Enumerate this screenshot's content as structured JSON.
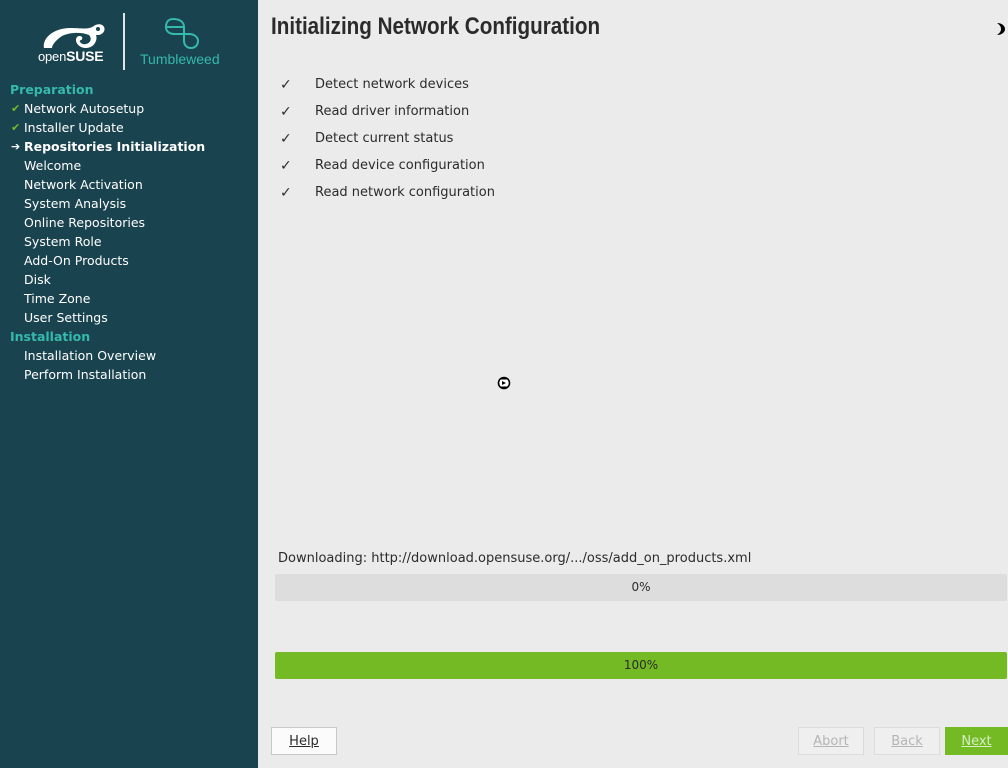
{
  "branding": {
    "product_prefix": "open",
    "product_suffix": "SUSE",
    "flavor": "Tumbleweed"
  },
  "sidebar": {
    "sections": [
      {
        "heading": "Preparation",
        "steps": [
          {
            "label": "Network Autosetup",
            "status": "done"
          },
          {
            "label": "Installer Update",
            "status": "done"
          },
          {
            "label": "Repositories Initialization",
            "status": "current"
          },
          {
            "label": "Welcome",
            "status": "pending"
          },
          {
            "label": "Network Activation",
            "status": "pending"
          },
          {
            "label": "System Analysis",
            "status": "pending"
          },
          {
            "label": "Online Repositories",
            "status": "pending"
          },
          {
            "label": "System Role",
            "status": "pending"
          },
          {
            "label": "Add-On Products",
            "status": "pending"
          },
          {
            "label": "Disk",
            "status": "pending"
          },
          {
            "label": "Time Zone",
            "status": "pending"
          },
          {
            "label": "User Settings",
            "status": "pending"
          }
        ]
      },
      {
        "heading": "Installation",
        "steps": [
          {
            "label": "Installation Overview",
            "status": "pending"
          },
          {
            "label": "Perform Installation",
            "status": "pending"
          }
        ]
      }
    ]
  },
  "main": {
    "title": "Initializing Network Configuration",
    "tasks": [
      {
        "label": "Detect network devices",
        "done": true
      },
      {
        "label": "Read driver information",
        "done": true
      },
      {
        "label": "Detect current status",
        "done": true
      },
      {
        "label": "Read device configuration",
        "done": true
      },
      {
        "label": "Read network configuration",
        "done": true
      }
    ],
    "download_label": "Downloading: http://download.opensuse.org/.../oss/add_on_products.xml",
    "download_progress": {
      "percent": 0,
      "text": "0%"
    },
    "total_progress": {
      "percent": 100,
      "text": "100%"
    }
  },
  "buttons": {
    "help": "Help",
    "abort": "Abort",
    "back": "Back",
    "next": "Next"
  },
  "colors": {
    "sidebar_bg": "#1a4350",
    "accent_teal": "#35b9ab",
    "accent_green": "#73ba25",
    "main_bg": "#ebebeb"
  },
  "icons": {
    "done_step": "check-icon",
    "current_step": "arrow-right-icon",
    "task_done": "check-icon",
    "busy": "busy-cursor-icon",
    "theme": "moon-icon"
  }
}
